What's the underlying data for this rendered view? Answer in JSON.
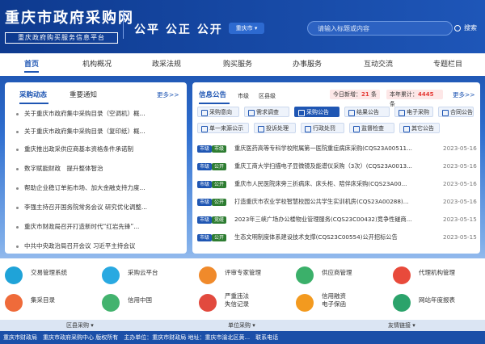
{
  "header": {
    "title": "重庆市政府采购网",
    "subtitle": "重庆政府购买服务信息平台",
    "slogan": "公平 公正 公开",
    "region": "重庆市 ▾",
    "search_placeholder": "请输入标题或内容",
    "search_button": "搜索"
  },
  "nav": [
    "首页",
    "机构概况",
    "政采法规",
    "购买服务",
    "办事服务",
    "互动交流",
    "专题栏目"
  ],
  "left": {
    "tabs": [
      "采购动态",
      "重要通知"
    ],
    "more": "更多>>",
    "items": [
      "关于重庆市政府集中采购目录（空调机）概...",
      "关于重庆市政府集中采购目录（复印纸）概...",
      "重庆推出政采供应商基本资格条件承诺制",
      "数字赋能财政　提升整体智治",
      "帮助企业稳订单拓市场、加大金融支持力度...",
      "李强主持召开国务院常务会议 研究优化调整...",
      "重庆市财政局召开打造新时代“红岩先锋”...",
      "中共中央政治局召开会议 习近平主持会议"
    ]
  },
  "right": {
    "title": "信息公告",
    "scope": [
      "市级",
      "区县级"
    ],
    "today_label": "今日新增：",
    "today_count": "21",
    "today_unit": "条",
    "year_label": "本年累计：",
    "year_count": "4445",
    "year_unit": "条",
    "more": "更多>>",
    "cats": [
      "采购意向",
      "需求调查",
      "采购公告",
      "结果公告",
      "电子采购",
      "合同公告",
      "单一来源公示",
      "投诉处理",
      "行政处罚",
      "监督检查",
      "其它公告"
    ],
    "rows": [
      {
        "badge": "市级",
        "text": "重庆医药高等专科学校附属第一医院重症病床采购(CQS23A00511...",
        "date": "2023-05-16"
      },
      {
        "badge": "公开",
        "text": "重庆工商大学扫描电子显微镜及能谱仪采购（3次）(CQS23A0013...",
        "date": "2023-05-16"
      },
      {
        "badge": "公开",
        "text": "重庆市人民医院床旁三折病床、床头柜、陪伴床采购(CQS23A00...",
        "date": "2023-05-16"
      },
      {
        "badge": "公开",
        "text": "打造重庆市农业学校智慧校园公共学生实训机房(CQS23A00288)...",
        "date": "2023-05-16"
      },
      {
        "badge": "竞磋",
        "text": "2023年三峡广场办公楼物业管理服务(CQS23C00432)竞争性磋商...",
        "date": "2023-05-15"
      },
      {
        "badge": "公开",
        "text": "生态文明制度体系建设技术支撑(CQS23C00554)公开招标公告",
        "date": "2023-05-15"
      }
    ]
  },
  "quick": [
    {
      "label": "交易管理系统",
      "color": "#1fa3d8"
    },
    {
      "label": "采购云平台",
      "color": "#29a9e1"
    },
    {
      "label": "评审专家管理",
      "color": "#f08a2b"
    },
    {
      "label": "供应商管理",
      "color": "#3bb06a"
    },
    {
      "label": "代理机构管理",
      "color": "#e84a3b"
    },
    {
      "label": "集采目录",
      "color": "#ef6b3a"
    },
    {
      "label": "信用中国",
      "color": "#43b36e"
    },
    {
      "label": "严重违法\n失信记录",
      "color": "#e24a3e"
    },
    {
      "label": "信用融资\n电子保函",
      "color": "#f39a1f"
    },
    {
      "label": "网站年度报表",
      "color": "#2ba36b"
    }
  ],
  "footer_tabs": [
    "区县采购 ▾",
    "单位采购 ▾",
    "友情链接 ▾"
  ],
  "bottom": "重庆市财政局　重庆市政府采购中心 版权所有　主办单位：重庆市财政局 地址：重庆市渝北区黄...　联系电话"
}
